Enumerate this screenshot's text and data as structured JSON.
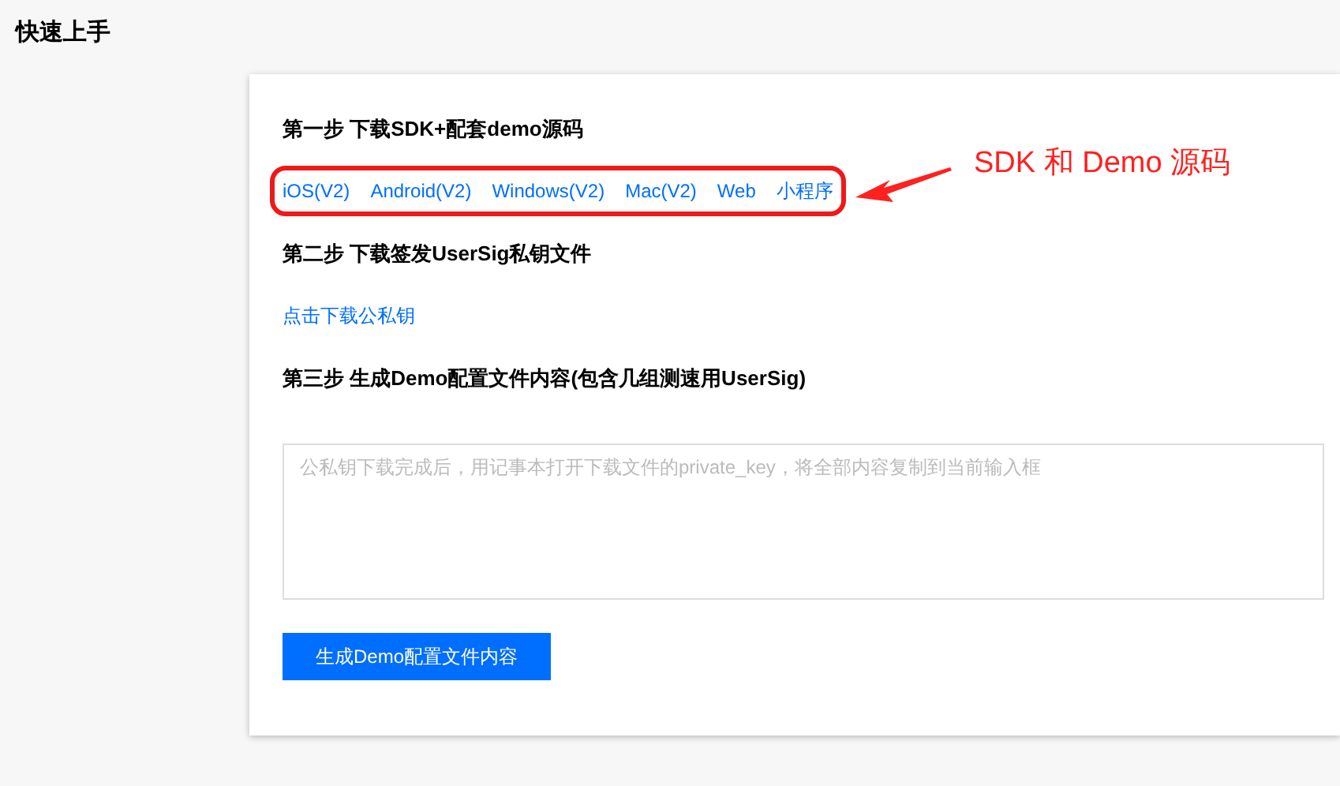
{
  "page_title": "快速上手",
  "steps": [
    {
      "kind": "links",
      "heading": "第一步 下载SDK+配套demo源码",
      "links": [
        "iOS(V2)",
        "Android(V2)",
        "Windows(V2)",
        "Mac(V2)",
        "Web",
        "小程序"
      ]
    },
    {
      "kind": "links",
      "heading": "第二步 下载签发UserSig私钥文件",
      "links": [
        "点击下载公私钥"
      ]
    },
    {
      "kind": "form",
      "heading": "第三步 生成Demo配置文件内容(包含几组测速用UserSig)",
      "placeholder": "公私钥下载完成后，用记事本打开下载文件的private_key，将全部内容复制到当前输入框",
      "button": "生成Demo配置文件内容"
    }
  ],
  "annotation": {
    "text": "SDK 和 Demo 源码"
  }
}
